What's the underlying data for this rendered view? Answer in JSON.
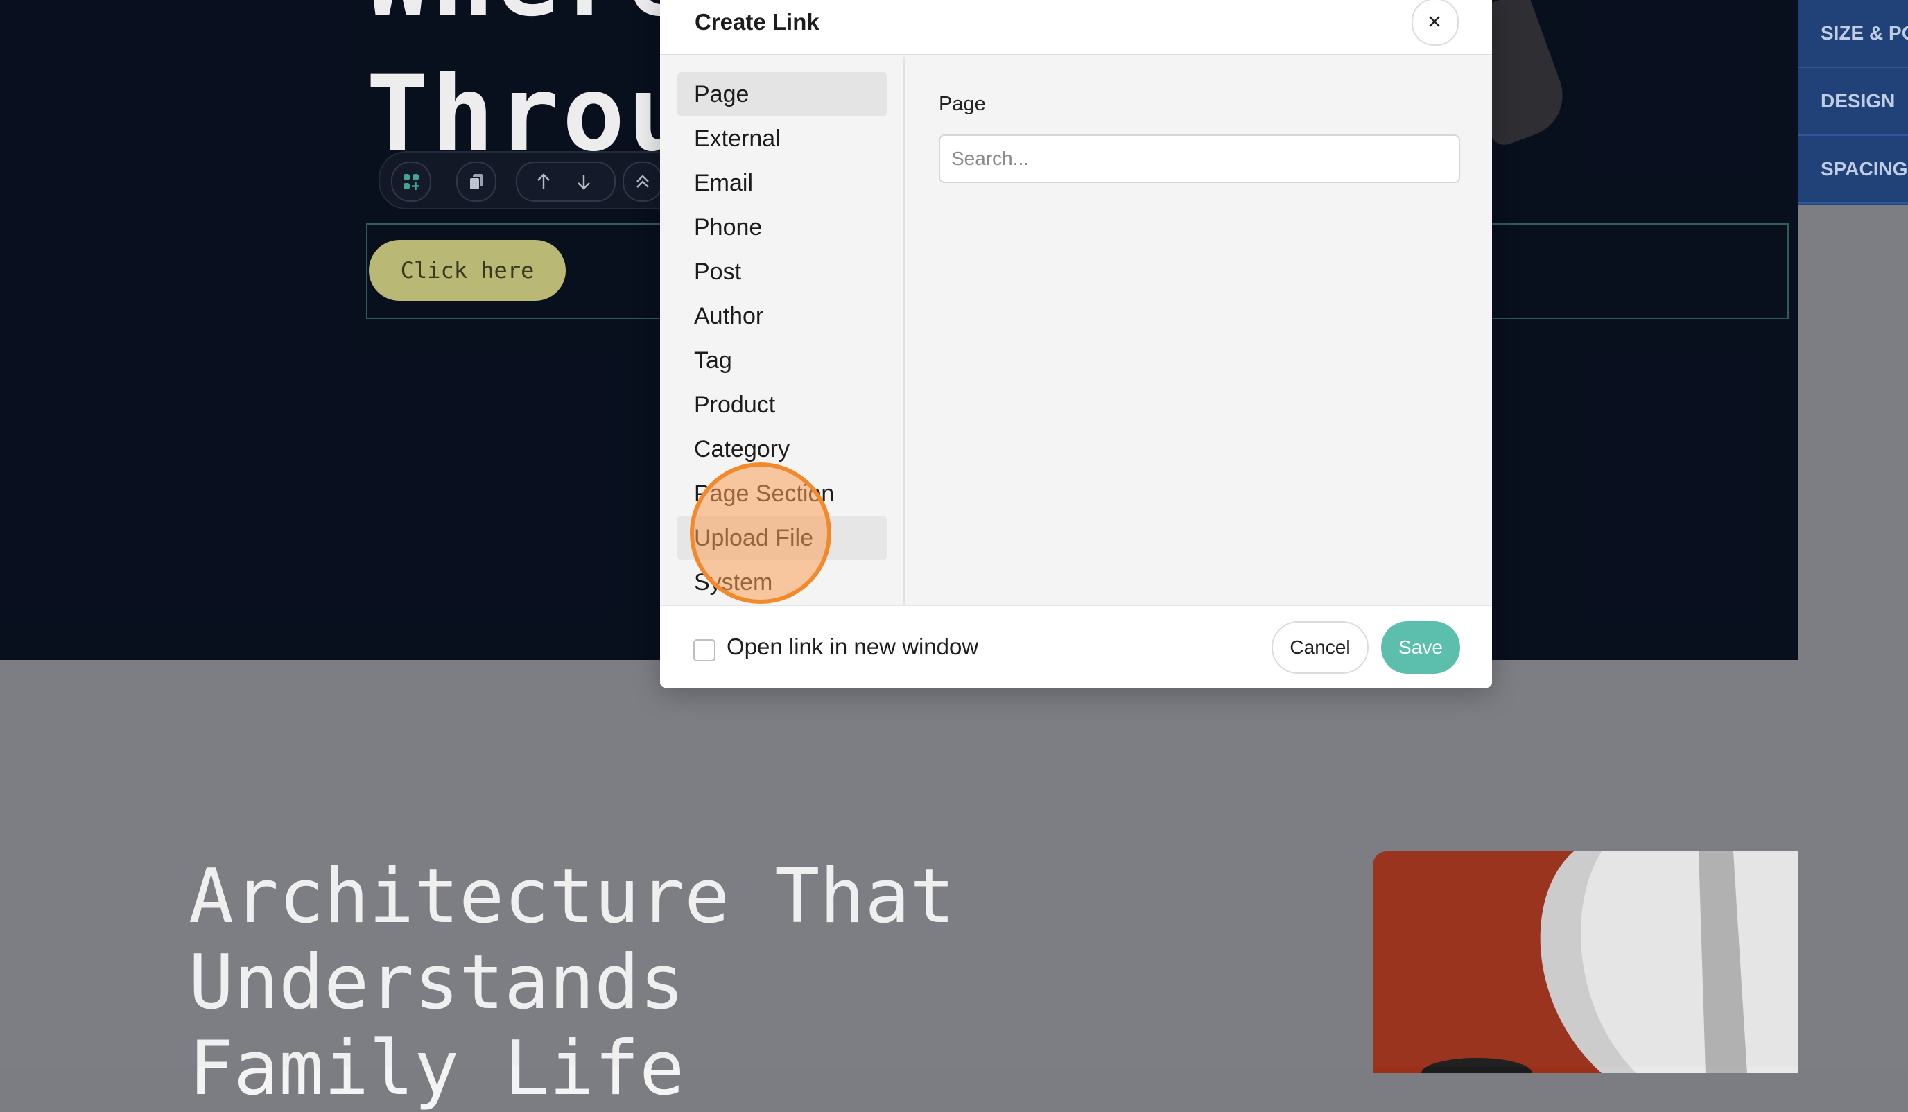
{
  "background_page": {
    "hero_heading_line1": "Where",
    "hero_heading_line2": "Throu",
    "cta_label": "Click here",
    "section_heading": [
      "Architecture That",
      "Understands",
      "Family Life"
    ],
    "right_panel_tabs": [
      "SIZE & PO",
      "DESIGN",
      "SPACING"
    ],
    "toolbar_icons": [
      "add-block-icon",
      "duplicate-icon",
      "move-up-icon",
      "move-down-icon",
      "collapse-icon"
    ]
  },
  "dialog": {
    "title": "Create Link",
    "close_icon": "close-icon",
    "link_types": [
      "Page",
      "External",
      "Email",
      "Phone",
      "Post",
      "Author",
      "Tag",
      "Product",
      "Category",
      "Page Section",
      "Upload File",
      "System"
    ],
    "active_type": "Page",
    "hovered_type": "Upload File",
    "content_label": "Page",
    "search_placeholder": "Search...",
    "new_window_label": "Open link in new window",
    "new_window_checked": false,
    "cancel_label": "Cancel",
    "save_label": "Save"
  },
  "colors": {
    "hero_bg": "#010817",
    "cta_bg": "#bbbb73",
    "panel_bg": "#1b3d78",
    "save_bg": "#5cbfad",
    "click_marker": "#f28a2c"
  }
}
